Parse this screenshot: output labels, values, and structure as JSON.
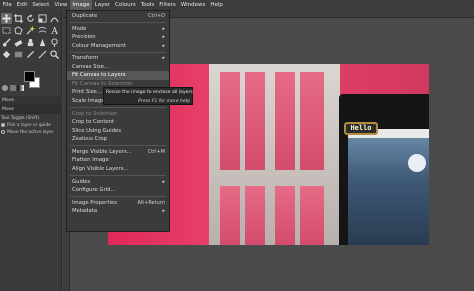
{
  "menubar": {
    "items": [
      "File",
      "Edit",
      "Select",
      "View",
      "Image",
      "Layer",
      "Colours",
      "Tools",
      "Filters",
      "Windows",
      "Help"
    ],
    "active_index": 4
  },
  "toolbox": {
    "tools": [
      "move-tool-icon",
      "crop-tool-icon",
      "rotate-tool-icon",
      "scale-tool-icon",
      "paths-tool-icon",
      "rect-select-icon",
      "free-select-icon",
      "fuzzy-select-icon",
      "warp-icon",
      "text-tool-icon",
      "paintbrush-icon",
      "eraser-icon",
      "clone-tool-icon",
      "smudge-tool-icon",
      "dodge-tool-icon",
      "bucket-fill-icon",
      "blend-icon",
      "color-picker-icon",
      "measure-icon",
      "zoom-tool-icon"
    ],
    "tab_move_label": "Move",
    "tab_move2_label": "Move",
    "tool_toggle_label": "Tool Toggle  (Shift)",
    "opt_pick_layer": "Pick a layer or guide",
    "opt_move_active": "Move the active layer"
  },
  "image_menu": {
    "items": [
      {
        "label": "Duplicate",
        "shortcut": "Ctrl+D"
      },
      {
        "label": "Mode",
        "submenu": true
      },
      {
        "label": "Precision",
        "submenu": true
      },
      {
        "label": "Colour Management",
        "submenu": true
      },
      {
        "label": "Transform",
        "submenu": true
      },
      {
        "label": "Canvas Size..."
      },
      {
        "label": "Fit Canvas to Layers",
        "highlighted": true
      },
      {
        "label": "Fit Canvas to Selection",
        "disabled": true
      },
      {
        "label": "Print Size..."
      },
      {
        "label": "Scale Image..."
      },
      {
        "label": "Crop to Selection",
        "disabled": true
      },
      {
        "label": "Crop to Content"
      },
      {
        "label": "Slice Using Guides"
      },
      {
        "label": "Zealous Crop"
      },
      {
        "label": "Merge Visible Layers...",
        "shortcut": "Ctrl+M"
      },
      {
        "label": "Flatten Image"
      },
      {
        "label": "Align Visible Layers..."
      },
      {
        "label": "Guides",
        "submenu": true
      },
      {
        "label": "Configure Grid..."
      },
      {
        "label": "Image Properties",
        "shortcut": "Alt+Return"
      },
      {
        "label": "Metadata",
        "submenu": true
      }
    ]
  },
  "tooltip": {
    "text": "Resize the image to enclose all layers",
    "hint": "Press F1 for more help"
  },
  "canvas": {
    "hello_label": "Hello"
  },
  "colors": {
    "foreground": "#000000",
    "background": "#ffffff"
  }
}
